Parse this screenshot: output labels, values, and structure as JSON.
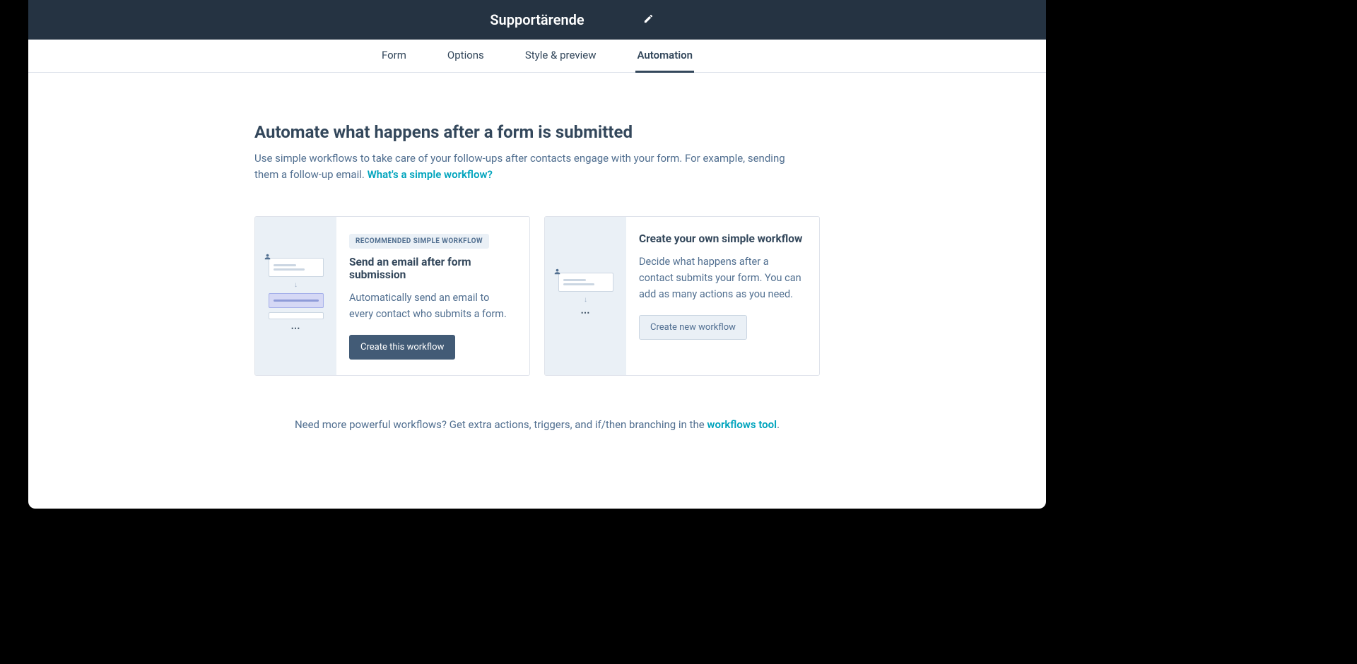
{
  "header": {
    "title": "Supportärende"
  },
  "tabs": [
    {
      "label": "Form",
      "active": false
    },
    {
      "label": "Options",
      "active": false
    },
    {
      "label": "Style & preview",
      "active": false
    },
    {
      "label": "Automation",
      "active": true
    }
  ],
  "main": {
    "heading": "Automate what happens after a form is submitted",
    "subheading_pre": "Use simple workflows to take care of your follow-ups after contacts engage with your form. For example, sending them a follow-up email.  ",
    "subheading_link": "What's a simple workflow?"
  },
  "cards": [
    {
      "badge": "RECOMMENDED SIMPLE WORKFLOW",
      "title": "Send an email after form submission",
      "description": "Automatically send an email to every contact who submits a form.",
      "button": "Create this workflow",
      "button_variant": "primary"
    },
    {
      "badge": "",
      "title": "Create your own simple workflow",
      "description": "Decide what happens after a contact submits your form. You can add as many actions as you need.",
      "button": "Create new workflow",
      "button_variant": "secondary"
    }
  ],
  "footer": {
    "text_pre": "Need more powerful workflows? Get extra actions, triggers, and if/then branching in the ",
    "link": "workflows tool",
    "text_post": "."
  }
}
